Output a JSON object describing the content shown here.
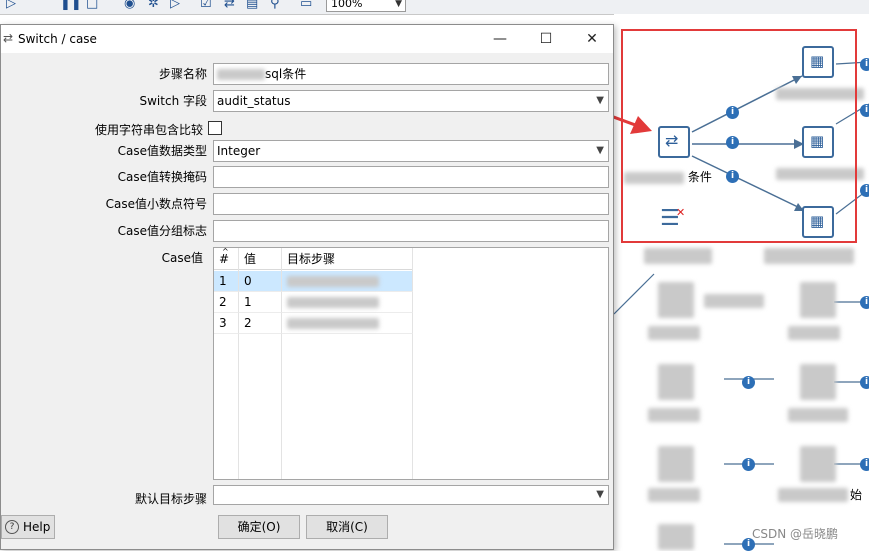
{
  "toolbar": {
    "zoom_value": "100%"
  },
  "dialog": {
    "title": "Switch / case",
    "step_name_label": "步骤名称",
    "step_name_value": "sql条件",
    "switch_field_label": "Switch 字段",
    "switch_field_value": "audit_status",
    "use_contains_label": "使用字符串包含比较",
    "data_type_label": "Case值数据类型",
    "data_type_value": "Integer",
    "conversion_mask_label": "Case值转换掩码",
    "decimal_symbol_label": "Case值小数点符号",
    "grouping_symbol_label": "Case值分组标志",
    "case_values_label": "Case值",
    "table": {
      "headers": [
        "#",
        "值",
        "目标步骤"
      ],
      "rows": [
        {
          "num": "1",
          "value": "0",
          "target": ""
        },
        {
          "num": "2",
          "value": "1",
          "target": ""
        },
        {
          "num": "3",
          "value": "2",
          "target": ""
        }
      ]
    },
    "default_target_label": "默认目标步骤",
    "ok_label": "确定(O)",
    "cancel_label": "取消(C)",
    "help_label": "Help"
  },
  "canvas": {
    "switch_node_label": "条件",
    "node_label_2": "始",
    "watermark": "CSDN @岳晓鹏"
  },
  "colors": {
    "highlight": "#e23a3a",
    "arrow": "#e23a3a",
    "node_border": "#3c6a9c",
    "info": "#2d6fb6"
  }
}
